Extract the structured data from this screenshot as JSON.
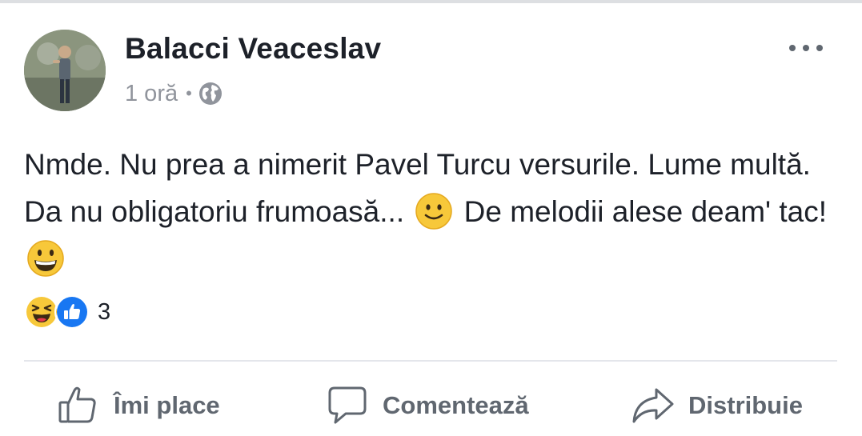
{
  "post": {
    "author": "Balacci Veaceslav",
    "time": "1 oră",
    "separator": "•",
    "privacy_icon": "globe-icon",
    "text_part1": "Nmde. Nu prea a nimerit Pavel Turcu versurile. Lume multă. Da nu obligatoriu frumoasă...",
    "emoji1": "slightly-smiling-face",
    "text_part2": "De melodii alese deam' tac!",
    "emoji2": "grinning-face"
  },
  "reactions": {
    "icons": [
      "haha-reaction-icon",
      "like-reaction-icon"
    ],
    "count": "3"
  },
  "actions": {
    "like_label": "Îmi place",
    "comment_label": "Comentează",
    "share_label": "Distribuie"
  },
  "colors": {
    "author_text": "#1d2129",
    "meta_text": "#90949c",
    "action_text": "#606770",
    "like_blue": "#1877f2",
    "emoji_yellow": "#f7c83a"
  }
}
